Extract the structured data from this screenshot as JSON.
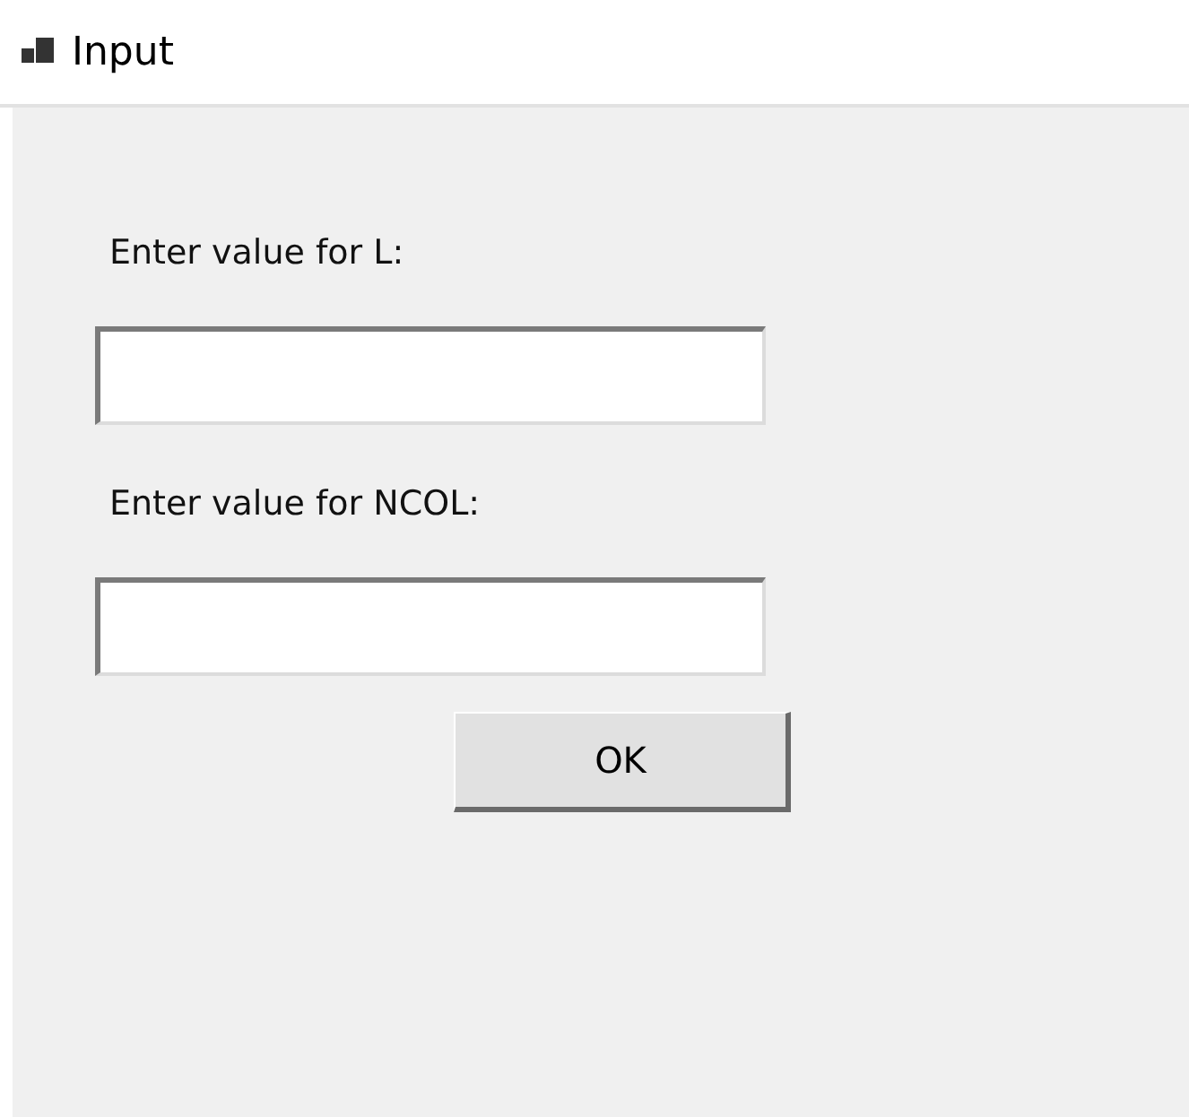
{
  "window": {
    "title": "Input"
  },
  "fields": [
    {
      "label": "Enter value for L:"
    },
    {
      "label": "Enter value for NCOL:"
    }
  ],
  "buttons": [
    "OK"
  ]
}
